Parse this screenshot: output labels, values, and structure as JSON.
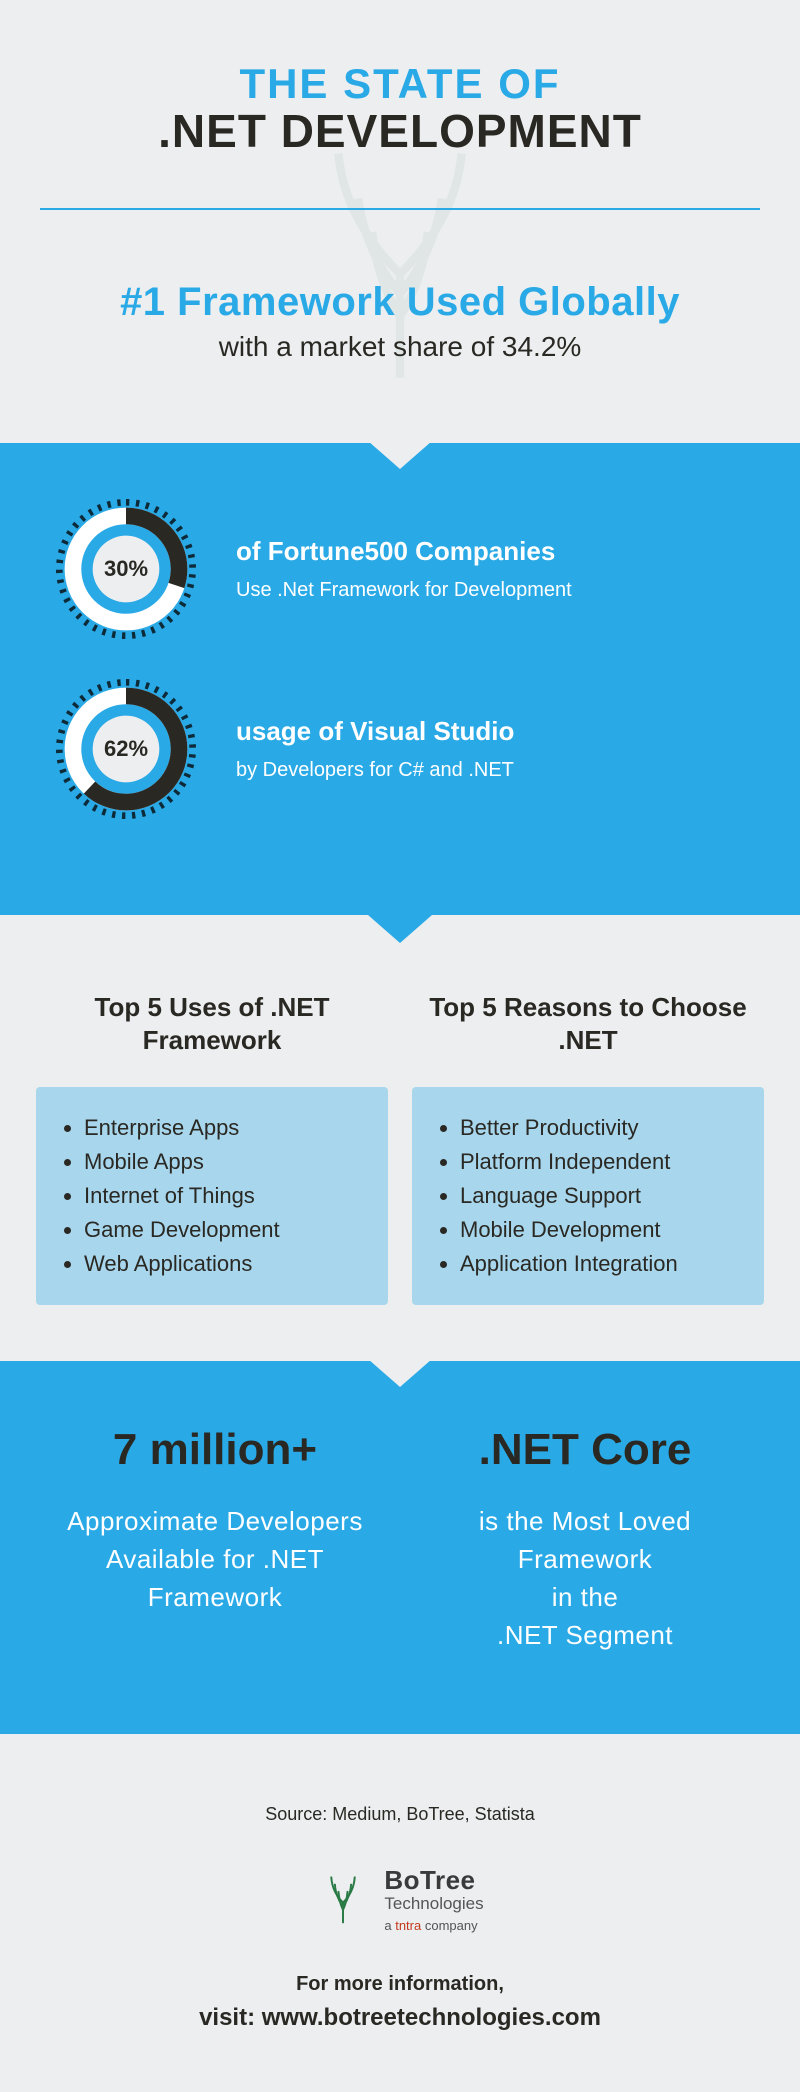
{
  "header": {
    "line1": "THE STATE OF",
    "line2": ".NET DEVELOPMENT"
  },
  "subhead": {
    "title": "#1 Framework Used Globally",
    "sub": "with a market share of 34.2%"
  },
  "stats": [
    {
      "value": "30%",
      "percent": 30,
      "title": "of Fortune500 Companies",
      "sub": "Use .Net Framework for Development"
    },
    {
      "value": "62%",
      "percent": 62,
      "title": "usage of Visual Studio",
      "sub": "by Developers for C# and .NET"
    }
  ],
  "lists": {
    "uses": {
      "heading": "Top 5 Uses of .NET Framework",
      "items": [
        "Enterprise Apps",
        "Mobile Apps",
        "Internet of Things",
        "Game Development",
        "Web Applications"
      ]
    },
    "reasons": {
      "heading": "Top 5 Reasons to Choose .NET",
      "items": [
        "Better Productivity",
        "Platform Independent",
        "Language Support",
        "Mobile Development",
        "Application Integration"
      ]
    }
  },
  "facts": [
    {
      "headline": "7 million+",
      "text": "Approximate Developers Available for .NET Framework"
    },
    {
      "headline": ".NET Core",
      "text": "is the Most Loved Framework\nin the\n.NET Segment"
    }
  ],
  "footer": {
    "source": "Source: Medium, BoTree, Statista",
    "logo_main": "BoTree",
    "logo_sub": "Technologies",
    "logo_tag_prefix": "a ",
    "logo_tag_accent": "tntra",
    "logo_tag_suffix": " company",
    "more_info": "For more information,",
    "visit": "visit: www.botreetechnologies.com"
  },
  "colors": {
    "accent": "#29a9e6",
    "dark": "#2a2823",
    "listbg": "#a8d7ed"
  },
  "chart_data": [
    {
      "type": "pie",
      "title": "Fortune500 Companies using .NET",
      "values": [
        30,
        70
      ]
    },
    {
      "type": "pie",
      "title": "Visual Studio usage",
      "values": [
        62,
        38
      ]
    }
  ]
}
